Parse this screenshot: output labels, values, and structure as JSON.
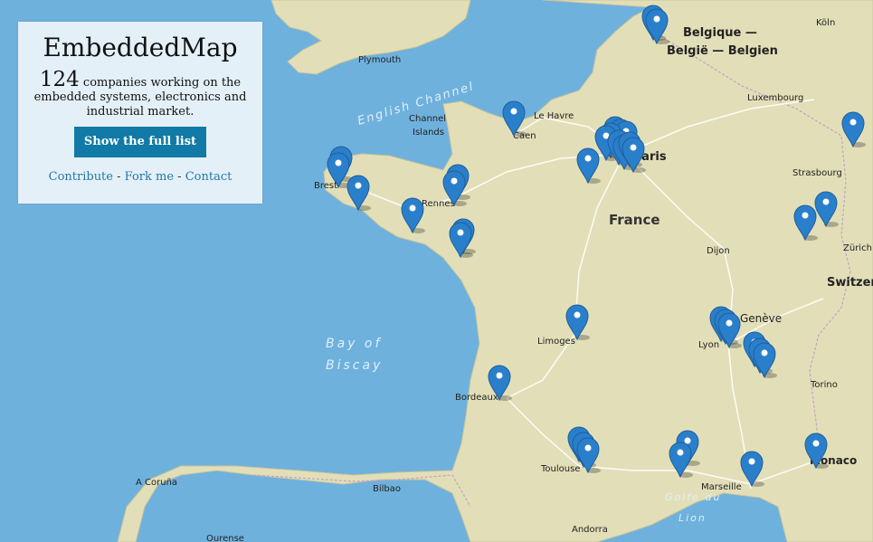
{
  "panel": {
    "title": "EmbeddedMap",
    "count": "124",
    "description": "companies working on the embedded systems, electronics and industrial market.",
    "button_label": "Show the full list",
    "links": [
      "Contribute",
      "Fork me",
      "Contact"
    ],
    "separator": " - "
  },
  "map": {
    "colors": {
      "sea": "#6fb1dd",
      "land": "#e2dfb8",
      "road": "#ffffff",
      "marker": "#2a7fcb",
      "marker_dark": "#1f5f9c"
    },
    "country_label": "France",
    "sea_labels": [
      "English Channel",
      "Bay of",
      "Biscay",
      "Golfe du",
      "Lion"
    ],
    "city_labels": [
      "Plymouth",
      "Belgique —",
      "België — Belgien",
      "Köln",
      "Luxembourg",
      "Le Havre",
      "Caen",
      "Channel",
      "Islands",
      "Paris",
      "Brest",
      "Rennes",
      "Strasbourg",
      "Zürich",
      "Dijon",
      "Switzer",
      "Genève",
      "Lyon",
      "Limoges",
      "Bordeaux",
      "Torino",
      "Toulouse",
      "Marseille",
      "Monaco",
      "A Coruña",
      "Bilbao",
      "Andorra",
      "Ourense"
    ],
    "marker_icon": "map-pin-icon"
  }
}
